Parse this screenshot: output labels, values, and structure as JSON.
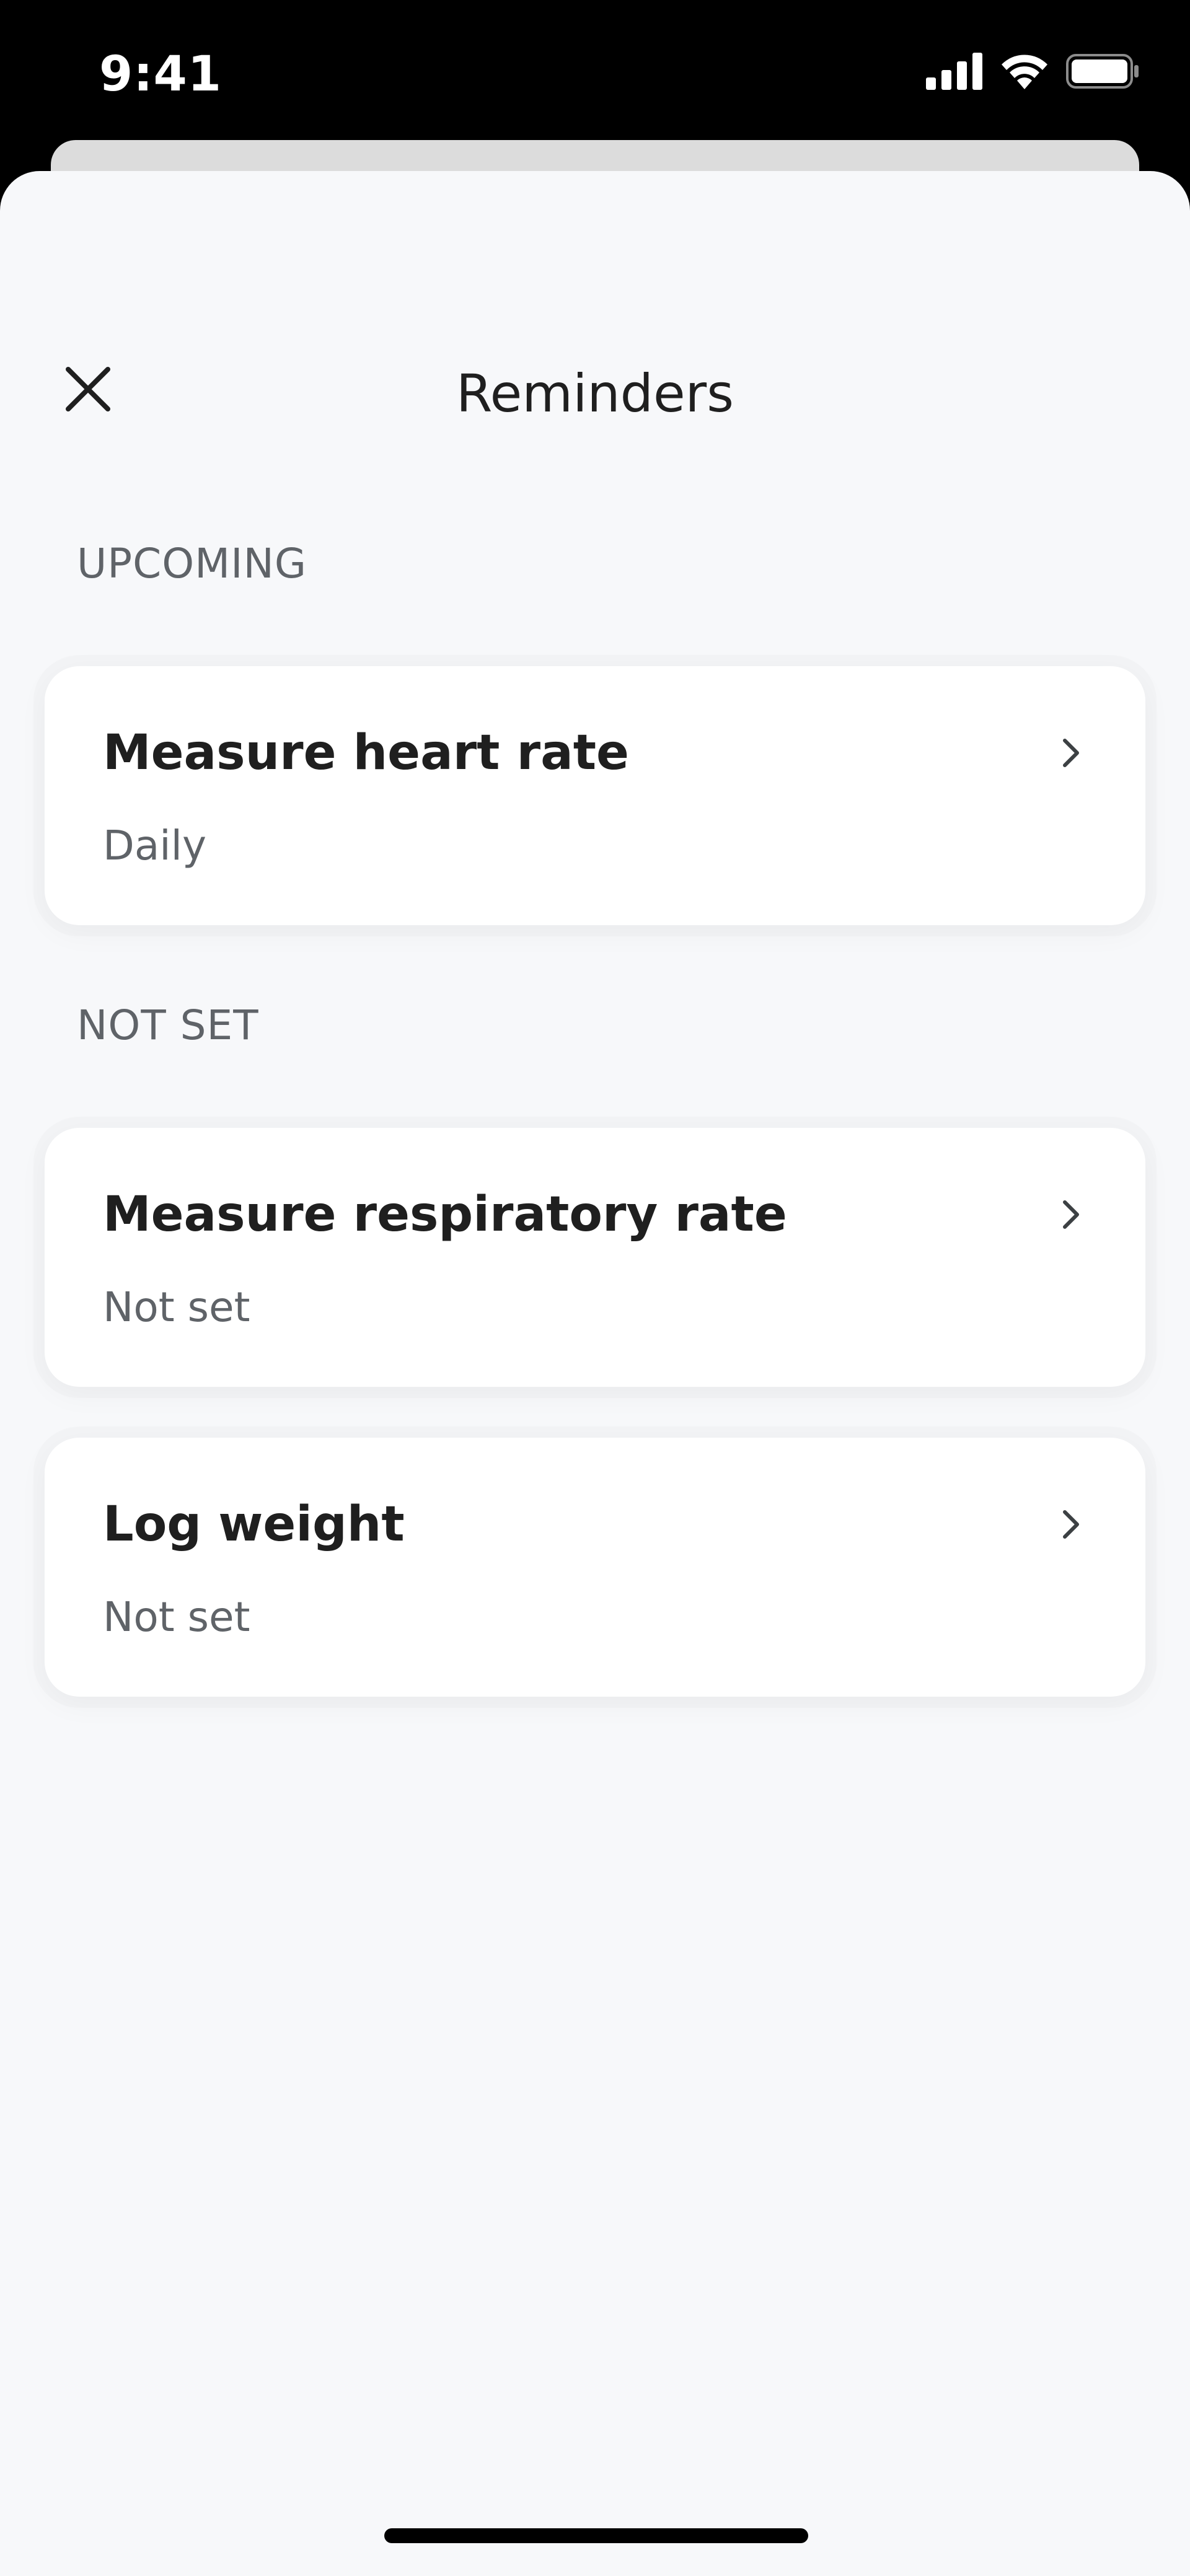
{
  "status_bar": {
    "time": "9:41",
    "icons": [
      "cellular-signal-icon",
      "wifi-icon",
      "battery-icon"
    ]
  },
  "header": {
    "title": "Reminders",
    "close_icon": "close-icon"
  },
  "sections": [
    {
      "label": "UPCOMING",
      "items": [
        {
          "title": "Measure heart rate",
          "subtitle": "Daily"
        }
      ]
    },
    {
      "label": "NOT SET",
      "items": [
        {
          "title": "Measure respiratory rate",
          "subtitle": "Not set"
        },
        {
          "title": "Log weight",
          "subtitle": "Not set"
        }
      ]
    }
  ],
  "colors": {
    "background": "#f7f8fa",
    "card": "#ffffff",
    "title_text": "#1f1f1f",
    "secondary_text": "#5f6368",
    "status_bar": "#000000"
  }
}
